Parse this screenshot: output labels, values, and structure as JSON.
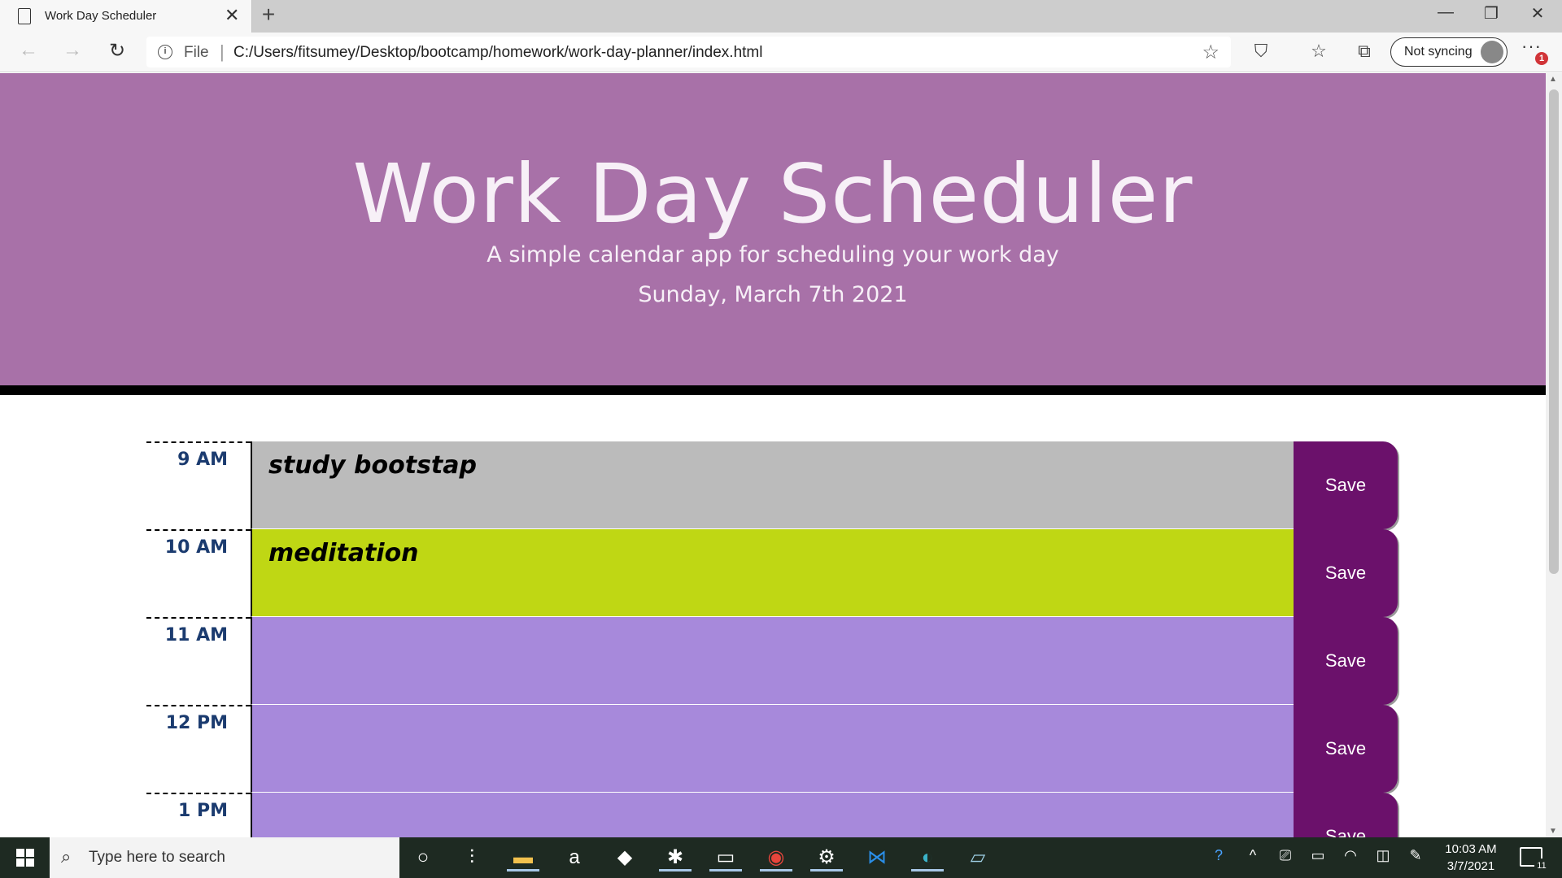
{
  "browser": {
    "tab_title": "Work Day Scheduler",
    "url_scheme_label": "File",
    "url": "C:/Users/fitsumey/Desktop/bootcamp/homework/work-day-planner/index.html",
    "sync_label": "Not syncing",
    "notification_badge": "1"
  },
  "page": {
    "title": "Work Day Scheduler",
    "subtitle": "A simple calendar app for scheduling your work day",
    "current_day": "Sunday, March 7th 2021",
    "colors": {
      "header": "#a871a8",
      "past": "#bbbbbb",
      "present": "#bfd714",
      "future": "#a789db",
      "save": "#6b116b"
    },
    "rows": [
      {
        "hour": "9 AM",
        "text": "study bootstap",
        "state": "past",
        "save_label": "Save"
      },
      {
        "hour": "10 AM",
        "text": "meditation",
        "state": "present",
        "save_label": "Save"
      },
      {
        "hour": "11 AM",
        "text": "",
        "state": "future",
        "save_label": "Save"
      },
      {
        "hour": "12 PM",
        "text": "",
        "state": "future",
        "save_label": "Save"
      },
      {
        "hour": "1 PM",
        "text": "",
        "state": "future",
        "save_label": "Save"
      }
    ]
  },
  "taskbar": {
    "search_placeholder": "Type here to search",
    "time": "10:03 AM",
    "date": "3/7/2021",
    "notification_count": "11"
  }
}
